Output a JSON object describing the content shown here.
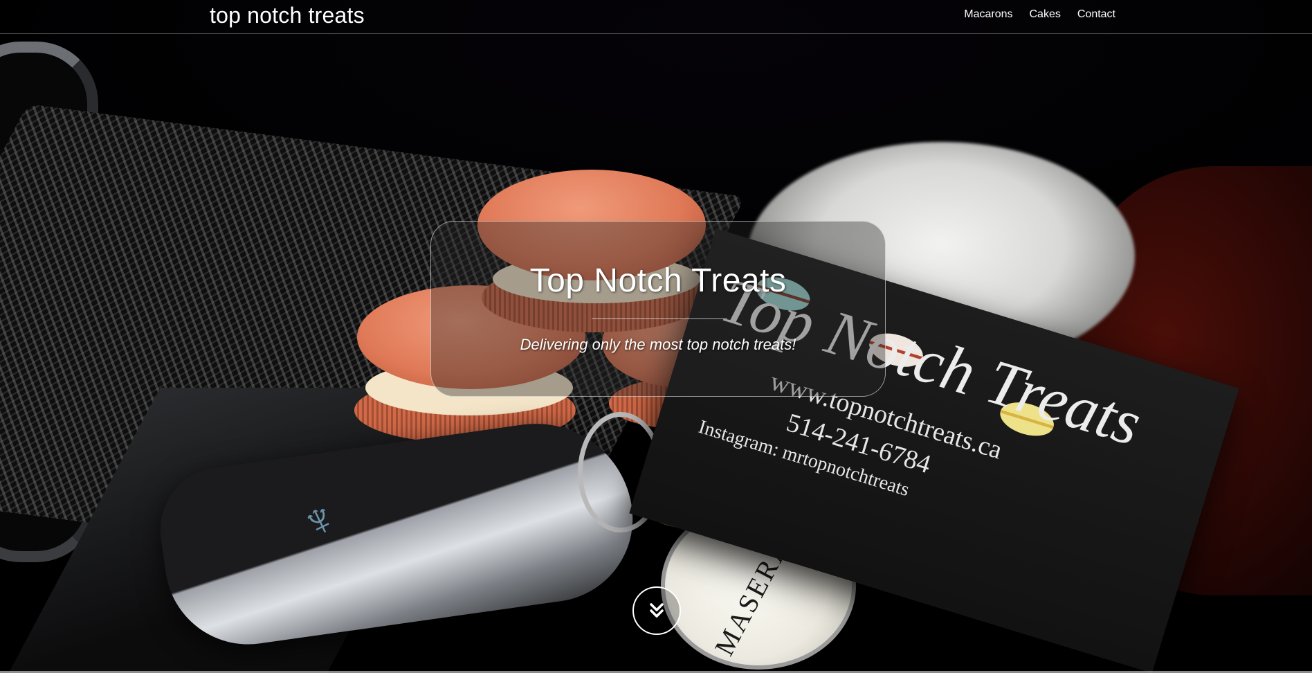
{
  "navbar": {
    "brand": "top notch treats",
    "links": [
      {
        "label": "Macarons"
      },
      {
        "label": "Cakes"
      },
      {
        "label": "Contact"
      }
    ]
  },
  "hero": {
    "title": "Top Notch Treats",
    "subtitle": "Delivering only the most top notch treats!",
    "scroll_icon": "chevron-double-down-icon"
  },
  "background_photo": {
    "business_card": {
      "title": "Top Notch Treats",
      "website": "www.topnotchtreats.ca",
      "phone": "514-241-6784",
      "instagram": "Instagram: mrtopnotchtreats"
    },
    "key_tag_text": "MASERATI"
  },
  "colors": {
    "text": "#ffffff",
    "macaron": "#e07a58",
    "background": "#000000"
  }
}
